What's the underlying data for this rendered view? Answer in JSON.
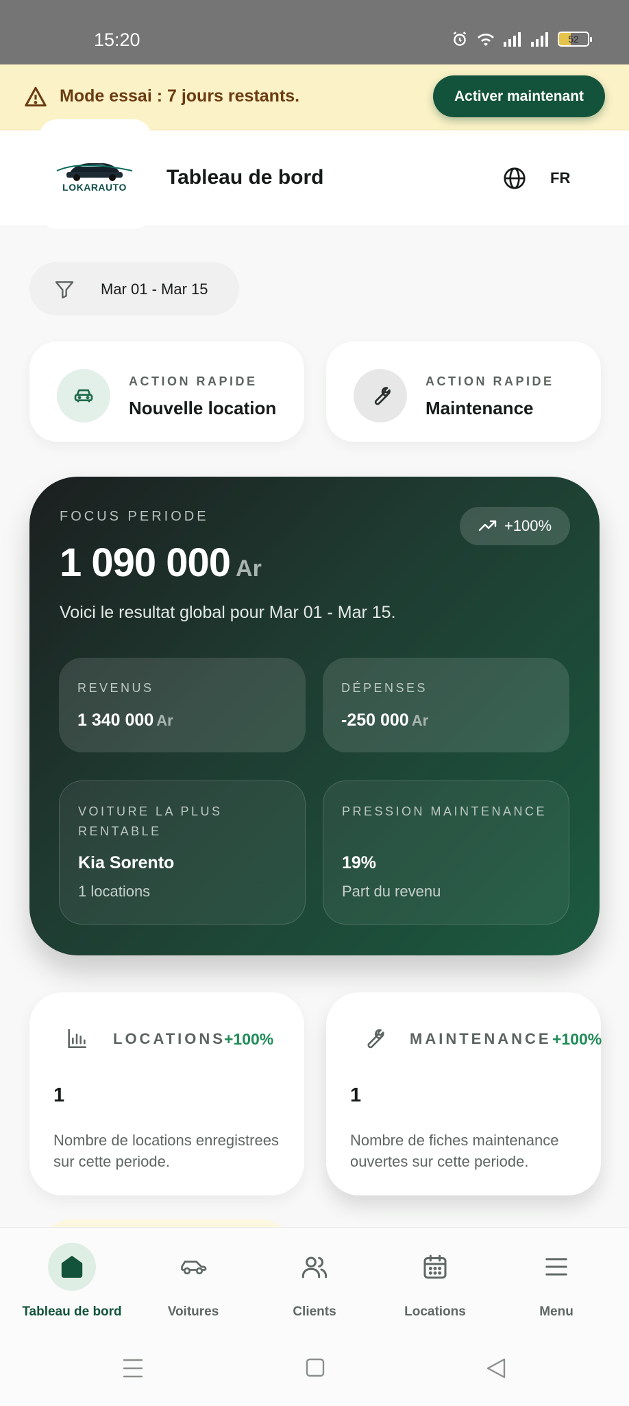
{
  "status_bar": {
    "time": "15:20",
    "battery": "52"
  },
  "trial_banner": {
    "message": "Mode essai : 7 jours restants.",
    "cta": "Activer maintenant"
  },
  "header": {
    "logo_text": "LOKARAUTO",
    "title": "Tableau de bord",
    "language": "FR"
  },
  "filter": {
    "date_range": "Mar 01 - Mar 15"
  },
  "quick_actions": [
    {
      "eyebrow": "ACTION RAPIDE",
      "label": "Nouvelle location",
      "icon": "car-icon"
    },
    {
      "eyebrow": "ACTION RAPIDE",
      "label": "Maintenance",
      "icon": "wrench-icon"
    }
  ],
  "focus": {
    "eyebrow": "FOCUS PERIODE",
    "trend": "+100%",
    "amount": "1 090 000",
    "currency": "Ar",
    "summary": "Voici le resultat global pour Mar 01 - Mar 15.",
    "revenue": {
      "label": "REVENUS",
      "value": "1 340 000",
      "unit": "Ar"
    },
    "expenses": {
      "label": "DÉPENSES",
      "value": "-250 000",
      "unit": "Ar"
    },
    "top_car": {
      "label": "VOITURE LA PLUS RENTABLE",
      "value": "Kia Sorento",
      "sub": "1 locations"
    },
    "maintenance_pressure": {
      "label": "PRESSION MAINTENANCE",
      "value": "19%",
      "sub": "Part du revenu"
    }
  },
  "metrics": [
    {
      "label": "LOCATIONS",
      "trend": "+100%",
      "value": "1",
      "description": "Nombre de locations enregistrees sur cette periode."
    },
    {
      "label": "MAINTENANCE",
      "trend": "+100%",
      "value": "1",
      "description": "Nombre de fiches maintenance ouvertes sur cette periode."
    }
  ],
  "bottom_nav": [
    {
      "label": "Tableau de bord",
      "icon": "home-icon",
      "active": true
    },
    {
      "label": "Voitures",
      "icon": "car-icon"
    },
    {
      "label": "Clients",
      "icon": "users-icon"
    },
    {
      "label": "Locations",
      "icon": "calendar-icon"
    },
    {
      "label": "Menu",
      "icon": "menu-icon"
    }
  ],
  "colors": {
    "brand": "#14533b",
    "accent_green": "#1f8b57",
    "banner": "#fcf2c7",
    "banner_text": "#6b3c12"
  }
}
